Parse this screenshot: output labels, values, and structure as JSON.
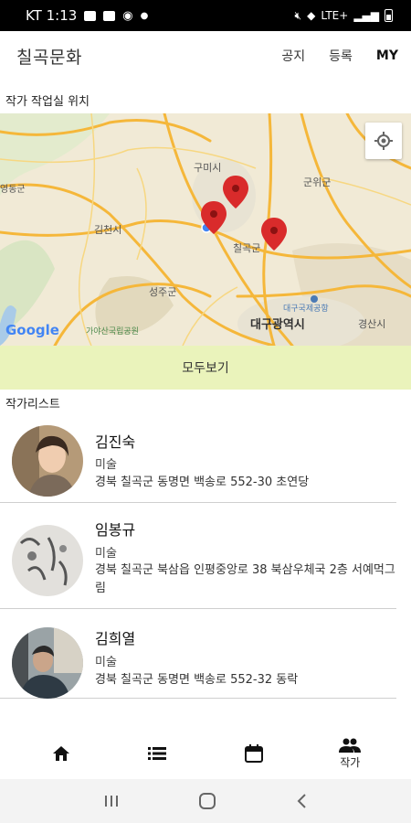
{
  "status_bar": {
    "carrier_time": "KT 1:13",
    "network": "LTE+"
  },
  "header": {
    "title": "칠곡문화",
    "nav": [
      "공지",
      "등록",
      "MY"
    ]
  },
  "map_section": {
    "label": "작가 작업실 위치",
    "place_labels": [
      "구미시",
      "군위군",
      "김천시",
      "칠곡군",
      "성주군",
      "대구광역시",
      "경산시",
      "대구국제공항",
      "가야산국립공원",
      "영동군"
    ],
    "google_logo": "Google",
    "show_all_button": "모두보기"
  },
  "list_section": {
    "label": "작가리스트",
    "artists": [
      {
        "name": "김진숙",
        "field": "미술",
        "address": "경북 칠곡군 동명면 백송로 552-30  초연당"
      },
      {
        "name": "임봉규",
        "field": "미술",
        "address": "경북 칠곡군 북삼읍 인평중앙로 38 북삼우체국 2층 서예먹그림"
      },
      {
        "name": "김희열",
        "field": "미술",
        "address": "경북 칠곡군 동명면 백송로 552-32  동락"
      }
    ]
  },
  "bottom_nav": {
    "items": [
      {
        "icon": "home-icon",
        "label": ""
      },
      {
        "icon": "list-icon",
        "label": ""
      },
      {
        "icon": "calendar-icon",
        "label": ""
      },
      {
        "icon": "people-icon",
        "label": "작가"
      }
    ]
  },
  "colors": {
    "accent_button": "#eaf3bb",
    "map_pin": "#d92b2b"
  }
}
